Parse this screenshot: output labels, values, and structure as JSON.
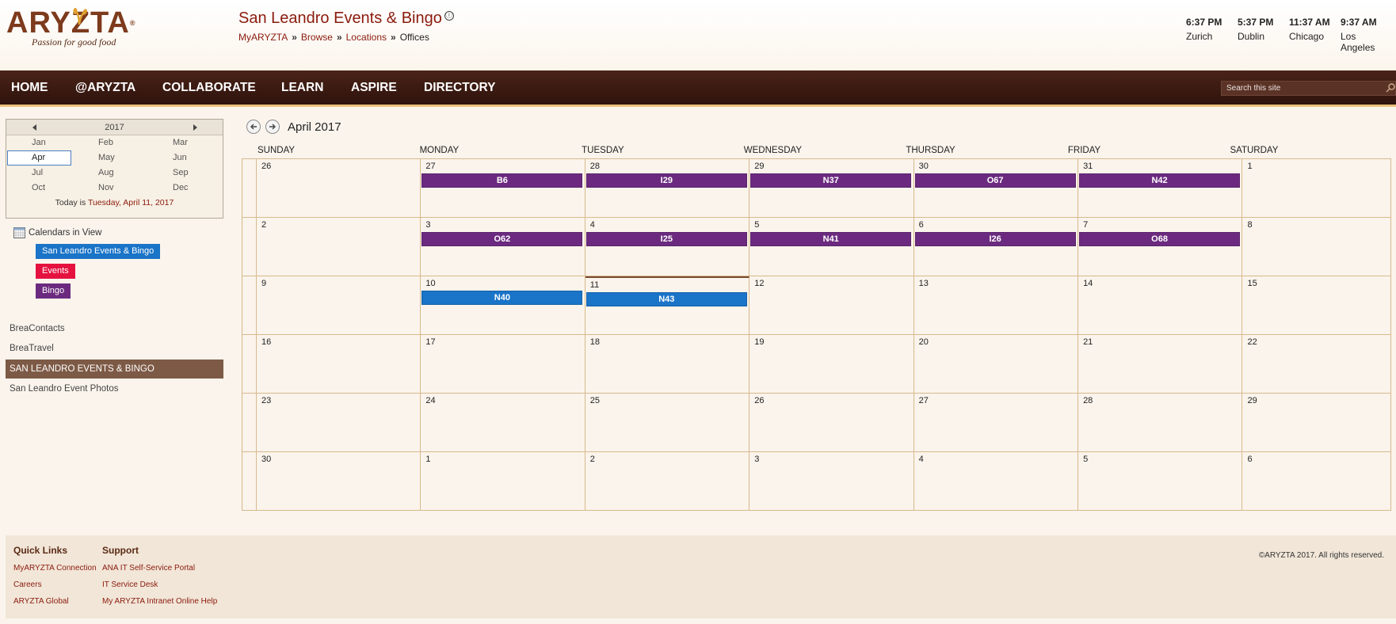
{
  "brand": {
    "logo_text": "ARYZTA",
    "registered": "®",
    "tagline": "Passion for good food"
  },
  "site": {
    "title": "San Leandro Events & Bingo",
    "info_icon": "ⓘ"
  },
  "breadcrumb": {
    "items": [
      "MyARYZTA",
      "Browse",
      "Locations"
    ],
    "current": "Offices",
    "separator": "»"
  },
  "clocks": [
    {
      "time": "6:37 PM",
      "city": "Zurich"
    },
    {
      "time": "5:37 PM",
      "city": "Dublin"
    },
    {
      "time": "11:37 AM",
      "city": "Chicago"
    },
    {
      "time": "9:37 AM",
      "city": "Los Angeles"
    }
  ],
  "nav": {
    "items": [
      "HOME",
      "@ARYZTA",
      "COLLABORATE",
      "LEARN",
      "ASPIRE",
      "DIRECTORY"
    ],
    "search_placeholder": "Search this site"
  },
  "datepicker": {
    "year": "2017",
    "months": [
      "Jan",
      "Feb",
      "Mar",
      "Apr",
      "May",
      "Jun",
      "Jul",
      "Aug",
      "Sep",
      "Oct",
      "Nov",
      "Dec"
    ],
    "selected_month": "Apr",
    "today_prefix": "Today is",
    "today_date": "Tuesday, April 11, 2017"
  },
  "calendars_in_view": {
    "label": "Calendars in View",
    "items": [
      {
        "name": "San Leandro Events & Bingo",
        "color": "#1a74c8"
      },
      {
        "name": "Events",
        "color": "#e5123f"
      },
      {
        "name": "Bingo",
        "color": "#6b2a7f"
      }
    ]
  },
  "quick_nav": {
    "items": [
      "BreaContacts",
      "BreaTravel",
      "San Leandro Events & Bingo",
      "San Leandro Event Photos"
    ],
    "selected": "San Leandro Events & Bingo"
  },
  "calendar": {
    "month_title": "April 2017",
    "days_of_week": [
      "SUNDAY",
      "MONDAY",
      "TUESDAY",
      "WEDNESDAY",
      "THURSDAY",
      "FRIDAY",
      "SATURDAY"
    ],
    "weeks": [
      [
        "26",
        "27",
        "28",
        "29",
        "30",
        "31",
        "1"
      ],
      [
        "2",
        "3",
        "4",
        "5",
        "6",
        "7",
        "8"
      ],
      [
        "9",
        "10",
        "11",
        "12",
        "13",
        "14",
        "15"
      ],
      [
        "16",
        "17",
        "18",
        "19",
        "20",
        "21",
        "22"
      ],
      [
        "23",
        "24",
        "25",
        "26",
        "27",
        "28",
        "29"
      ],
      [
        "30",
        "1",
        "2",
        "3",
        "4",
        "5",
        "6"
      ]
    ],
    "today": {
      "week": 2,
      "day": 2
    },
    "events": [
      {
        "week": 0,
        "day": 1,
        "label": "B6",
        "color": "#6b2a7f"
      },
      {
        "week": 0,
        "day": 2,
        "label": "I29",
        "color": "#6b2a7f"
      },
      {
        "week": 0,
        "day": 3,
        "label": "N37",
        "color": "#6b2a7f"
      },
      {
        "week": 0,
        "day": 4,
        "label": "O67",
        "color": "#6b2a7f"
      },
      {
        "week": 0,
        "day": 5,
        "label": "N42",
        "color": "#6b2a7f"
      },
      {
        "week": 1,
        "day": 1,
        "label": "O62",
        "color": "#6b2a7f"
      },
      {
        "week": 1,
        "day": 2,
        "label": "I25",
        "color": "#6b2a7f"
      },
      {
        "week": 1,
        "day": 3,
        "label": "N41",
        "color": "#6b2a7f"
      },
      {
        "week": 1,
        "day": 4,
        "label": "I26",
        "color": "#6b2a7f"
      },
      {
        "week": 1,
        "day": 5,
        "label": "O68",
        "color": "#6b2a7f"
      },
      {
        "week": 2,
        "day": 1,
        "label": "N40",
        "color": "#1a74c8"
      },
      {
        "week": 2,
        "day": 2,
        "label": "N43",
        "color": "#1a74c8"
      }
    ]
  },
  "footer": {
    "quick_links": {
      "heading": "Quick Links",
      "links": [
        "MyARYZTA Connection",
        "Careers",
        "ARYZTA Global"
      ]
    },
    "support": {
      "heading": "Support",
      "links": [
        "ANA IT Self-Service Portal",
        "IT Service Desk",
        "My ARYZTA Intranet Online Help"
      ]
    },
    "copyright": "©ARYZTA 2017. All rights reserved."
  }
}
